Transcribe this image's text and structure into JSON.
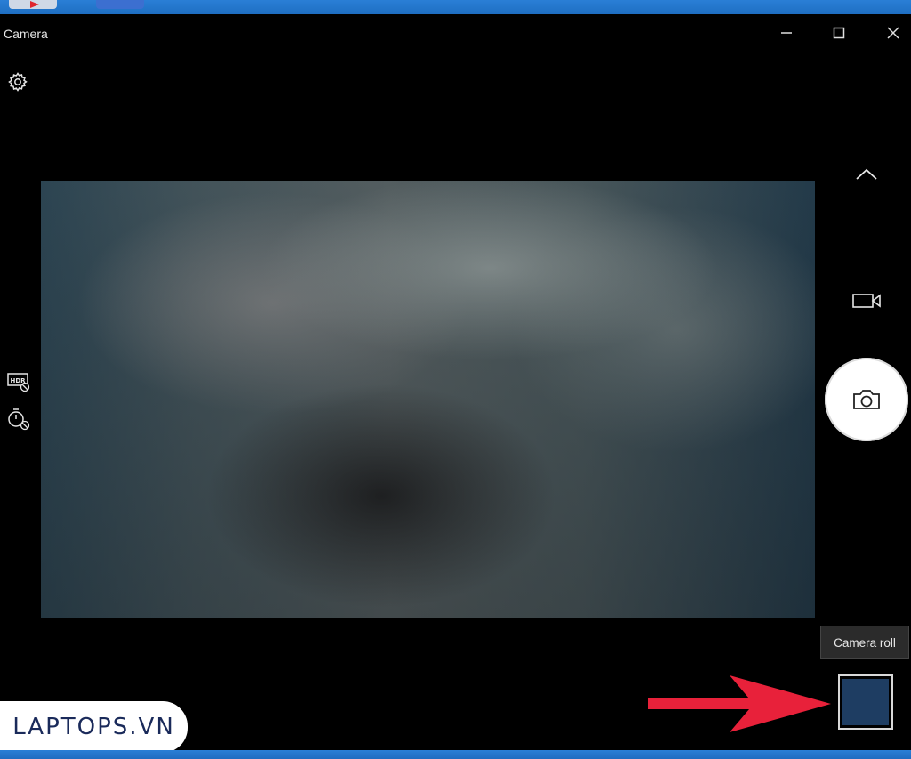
{
  "app": {
    "title": "Camera"
  },
  "window_controls": {
    "minimize": "minimize-icon",
    "maximize": "maximize-icon",
    "close": "close-icon"
  },
  "left_controls": {
    "settings": "gear-icon",
    "hdr": "hdr-off-icon",
    "timer": "timer-off-icon"
  },
  "right_controls": {
    "collapse": "chevron-up-icon",
    "video_mode": "video-camera-icon",
    "take_photo": "camera-icon"
  },
  "camera_roll": {
    "tooltip": "Camera roll",
    "thumbnail_color": "#1e3d62"
  },
  "overlay": {
    "logo_text": "LAPTOPS.VN",
    "arrow_color": "#e8213a"
  },
  "colors": {
    "taskbar": "#1e6ec2",
    "background": "#000000"
  }
}
